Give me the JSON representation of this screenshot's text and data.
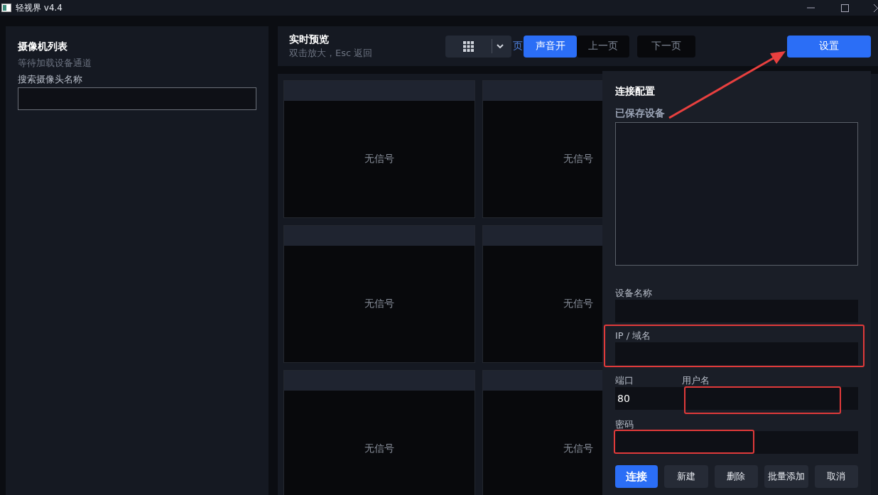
{
  "window": {
    "title": "轻视界 v4.4"
  },
  "sidebar": {
    "title": "摄像机列表",
    "status": "等待加载设备通道",
    "search_label": "搜索摄像头名称"
  },
  "preview": {
    "title": "实时预览",
    "hint": "双击放大，Esc 返回",
    "page_fragment": "页",
    "buttons": [
      {
        "label": "声音开",
        "kind": "primary"
      },
      {
        "label": "上一页",
        "kind": "dark"
      },
      {
        "label": "下一页",
        "kind": "dark"
      }
    ],
    "settings": {
      "label": "设置",
      "annotated": true
    }
  },
  "tiles": [
    {
      "status": "无信号"
    },
    {
      "status": "无信号"
    },
    {
      "status": "无信号"
    },
    {
      "status": "无信号"
    },
    {
      "status": "无信号"
    },
    {
      "status": "无信号"
    }
  ],
  "connect_panel": {
    "title": "连接配置",
    "saved_label": "已保存设备",
    "fields": [
      {
        "label": "设备名称",
        "highlighted": false
      },
      {
        "label": "IP / 域名",
        "highlighted": true
      },
      {
        "label": "端口",
        "value": "80",
        "highlighted": false
      },
      {
        "label": "用户名",
        "highlighted": true
      },
      {
        "label": "密码",
        "highlighted": true
      }
    ],
    "buttons": [
      {
        "label": "连接",
        "kind": "primary"
      },
      {
        "label": "新建",
        "kind": "plain"
      },
      {
        "label": "删除",
        "kind": "plain"
      },
      {
        "label": "批量添加",
        "kind": "plain"
      },
      {
        "label": "取消",
        "kind": "plain"
      }
    ]
  }
}
